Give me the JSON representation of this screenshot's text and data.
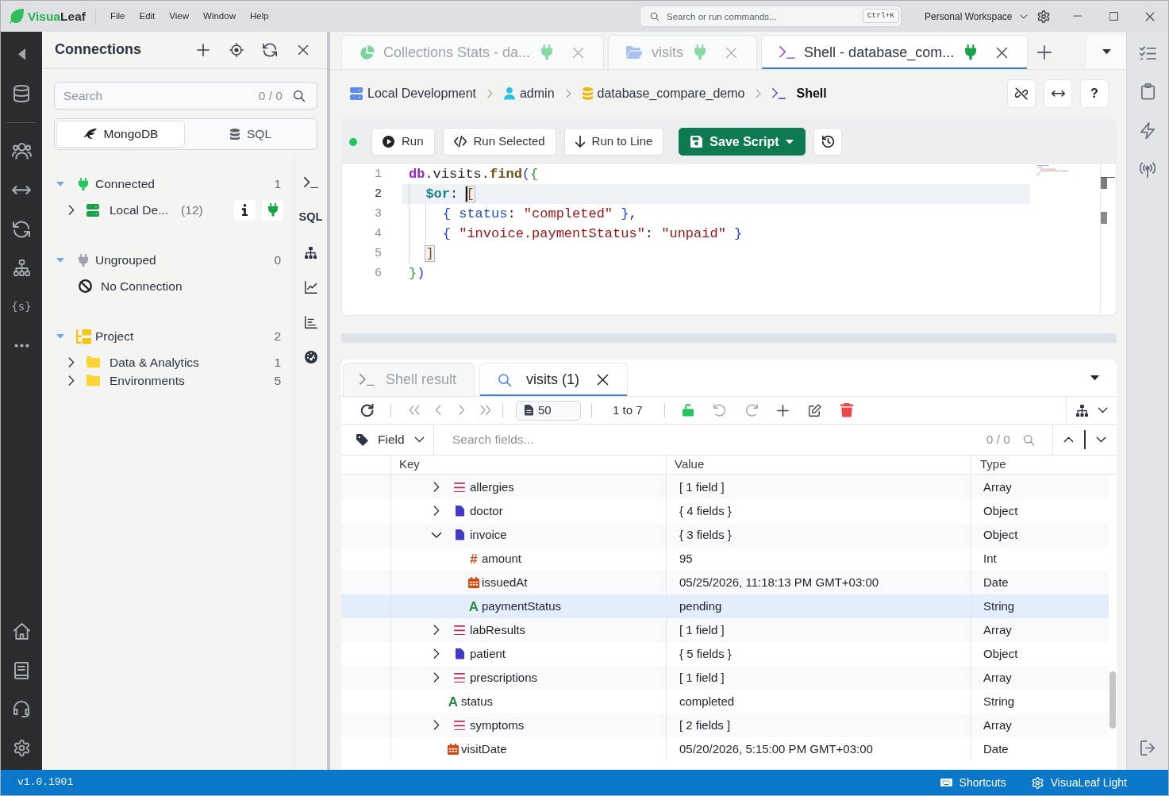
{
  "title_bar": {
    "logo": [
      {
        "text": "Visua",
        "accent": true
      },
      {
        "text": "Leaf",
        "accent": false
      }
    ],
    "menu": [
      "File",
      "Edit",
      "View",
      "Window",
      "Help"
    ],
    "command_search": {
      "placeholder": "Search or run commands...",
      "shortcut": "Ctrl+K"
    },
    "workspace": "Personal Workspace"
  },
  "activity_bar": {
    "snippets_label": "{s}"
  },
  "connections": {
    "title": "Connections",
    "search": {
      "placeholder": "Search",
      "count": "0 / 0"
    },
    "segments": [
      {
        "label": "MongoDB",
        "kind": "mongodb",
        "selected": true
      },
      {
        "label": "SQL",
        "kind": "sql",
        "selected": false
      }
    ],
    "groups": [
      {
        "label": "Connected",
        "kind": "connected",
        "count": "1",
        "expanded": true,
        "children": [
          {
            "label": "Local De...",
            "kind": "server",
            "count": "(12)",
            "expanded": false
          }
        ]
      },
      {
        "label": "Ungrouped",
        "kind": "ungrouped",
        "count": "0",
        "expanded": true,
        "children": [
          {
            "label": "No Connection",
            "kind": "none"
          }
        ]
      },
      {
        "label": "Project",
        "kind": "project",
        "count": "2",
        "expanded": true,
        "children": [
          {
            "label": "Data & Analytics",
            "kind": "folder",
            "count": "1",
            "expanded": false
          },
          {
            "label": "Environments",
            "kind": "folder",
            "count": "5",
            "expanded": false
          }
        ]
      }
    ]
  },
  "tool_strip": {
    "sql_label": "SQL"
  },
  "editor_tabs": [
    {
      "label": "Collections Stats - da...",
      "kind": "stats",
      "selected": false
    },
    {
      "label": "visits",
      "kind": "collection",
      "selected": false
    },
    {
      "label": "Shell - database_com...",
      "kind": "shell",
      "selected": true
    }
  ],
  "breadcrumb": [
    {
      "label": "Local Development",
      "kind": "server",
      "current": false
    },
    {
      "label": "admin",
      "kind": "user",
      "current": false
    },
    {
      "label": "database_compare_demo",
      "kind": "database",
      "current": false
    },
    {
      "label": "Shell",
      "kind": "shell",
      "current": true
    }
  ],
  "help_label": "?",
  "script_toolbar": {
    "connected": true,
    "buttons": [
      {
        "label": "Run",
        "kind": "run"
      },
      {
        "label": "Run Selected",
        "kind": "run-selected"
      },
      {
        "label": "Run to Line",
        "kind": "run-to-line"
      },
      {
        "label": "Save Script",
        "kind": "save"
      }
    ]
  },
  "editor": {
    "lines": [
      {
        "number": "1",
        "current": false,
        "tokens": [
          {
            "text": "db",
            "kind": "variable"
          },
          {
            "text": ".visits.",
            "kind": "plain"
          },
          {
            "text": "find",
            "kind": "method"
          },
          {
            "text": "(",
            "kind": "paren"
          },
          {
            "text": "{",
            "kind": "bracket-outer"
          }
        ]
      },
      {
        "number": "2",
        "current": true,
        "tokens": [
          {
            "text": "  $or",
            "kind": "operator"
          },
          {
            "text": ": ",
            "kind": "plain"
          },
          {
            "text": "[",
            "kind": "bracket-match"
          }
        ]
      },
      {
        "number": "3",
        "current": false,
        "tokens": [
          {
            "text": "    {",
            "kind": "brace"
          },
          {
            "text": " status",
            "kind": "key"
          },
          {
            "text": ": ",
            "kind": "plain"
          },
          {
            "text": "\"completed\"",
            "kind": "string"
          },
          {
            "text": " }",
            "kind": "brace"
          },
          {
            "text": ",",
            "kind": "plain"
          }
        ]
      },
      {
        "number": "4",
        "current": false,
        "tokens": [
          {
            "text": "    {",
            "kind": "brace"
          },
          {
            "text": " \"invoice.paymentStatus\"",
            "kind": "string"
          },
          {
            "text": ": ",
            "kind": "plain"
          },
          {
            "text": "\"unpaid\"",
            "kind": "string"
          },
          {
            "text": " }",
            "kind": "brace"
          }
        ]
      },
      {
        "number": "5",
        "current": false,
        "tokens": [
          {
            "text": "  ]",
            "kind": "bracket-match"
          }
        ]
      },
      {
        "number": "6",
        "current": false,
        "tokens": [
          {
            "text": "}",
            "kind": "bracket-outer"
          },
          {
            "text": ")",
            "kind": "paren"
          }
        ]
      }
    ]
  },
  "results": {
    "tabs": [
      {
        "label": "Shell result",
        "kind": "shell",
        "selected": false,
        "closable": false
      },
      {
        "label": "visits (1)",
        "kind": "query",
        "selected": true,
        "closable": true
      }
    ],
    "page_size": "50",
    "range": "1 to 7",
    "locked": false,
    "field_filter": {
      "label": "Field",
      "placeholder": "Search fields...",
      "count": "0 / 0"
    },
    "columns": [
      "Key",
      "Value",
      "Type"
    ],
    "rows": [
      {
        "key": "allergies",
        "value": "[ 1 field ]",
        "type": "Array",
        "kind": "array",
        "expanded": false,
        "selected": false
      },
      {
        "key": "doctor",
        "value": "{ 4 fields }",
        "type": "Object",
        "kind": "object",
        "expanded": false,
        "selected": false
      },
      {
        "key": "invoice",
        "value": "{ 3 fields }",
        "type": "Object",
        "kind": "object",
        "expanded": true,
        "selected": false,
        "children": [
          {
            "key": "amount",
            "glyph": "#",
            "value": "95",
            "type": "Int",
            "kind": "int",
            "selected": false
          },
          {
            "key": "issuedAt",
            "value": "05/25/2026, 11:18:13 PM GMT+03:00",
            "type": "Date",
            "kind": "date",
            "selected": false
          },
          {
            "key": "paymentStatus",
            "glyph": "A",
            "value": "pending",
            "type": "String",
            "kind": "string",
            "selected": true
          }
        ]
      },
      {
        "key": "labResults",
        "value": "[ 1 field ]",
        "type": "Array",
        "kind": "array",
        "expanded": false,
        "selected": false
      },
      {
        "key": "patient",
        "value": "{ 5 fields }",
        "type": "Object",
        "kind": "object",
        "expanded": false,
        "selected": false
      },
      {
        "key": "prescriptions",
        "value": "[ 1 field ]",
        "type": "Array",
        "kind": "array",
        "expanded": false,
        "selected": false
      },
      {
        "key": "status",
        "glyph": "A",
        "value": "completed",
        "type": "String",
        "kind": "string",
        "selected": false
      },
      {
        "key": "symptoms",
        "value": "[ 2 fields ]",
        "type": "Array",
        "kind": "array",
        "expanded": false,
        "selected": false
      },
      {
        "key": "visitDate",
        "value": "05/20/2026, 5:15:00 PM GMT+03:00",
        "type": "Date",
        "kind": "date",
        "selected": false
      }
    ]
  },
  "status_bar": {
    "version": "v1.0.1901",
    "items": [
      {
        "label": "Shortcuts",
        "kind": "keyboard"
      },
      {
        "label": "VisuaLeaf Light",
        "kind": "theme"
      }
    ]
  }
}
